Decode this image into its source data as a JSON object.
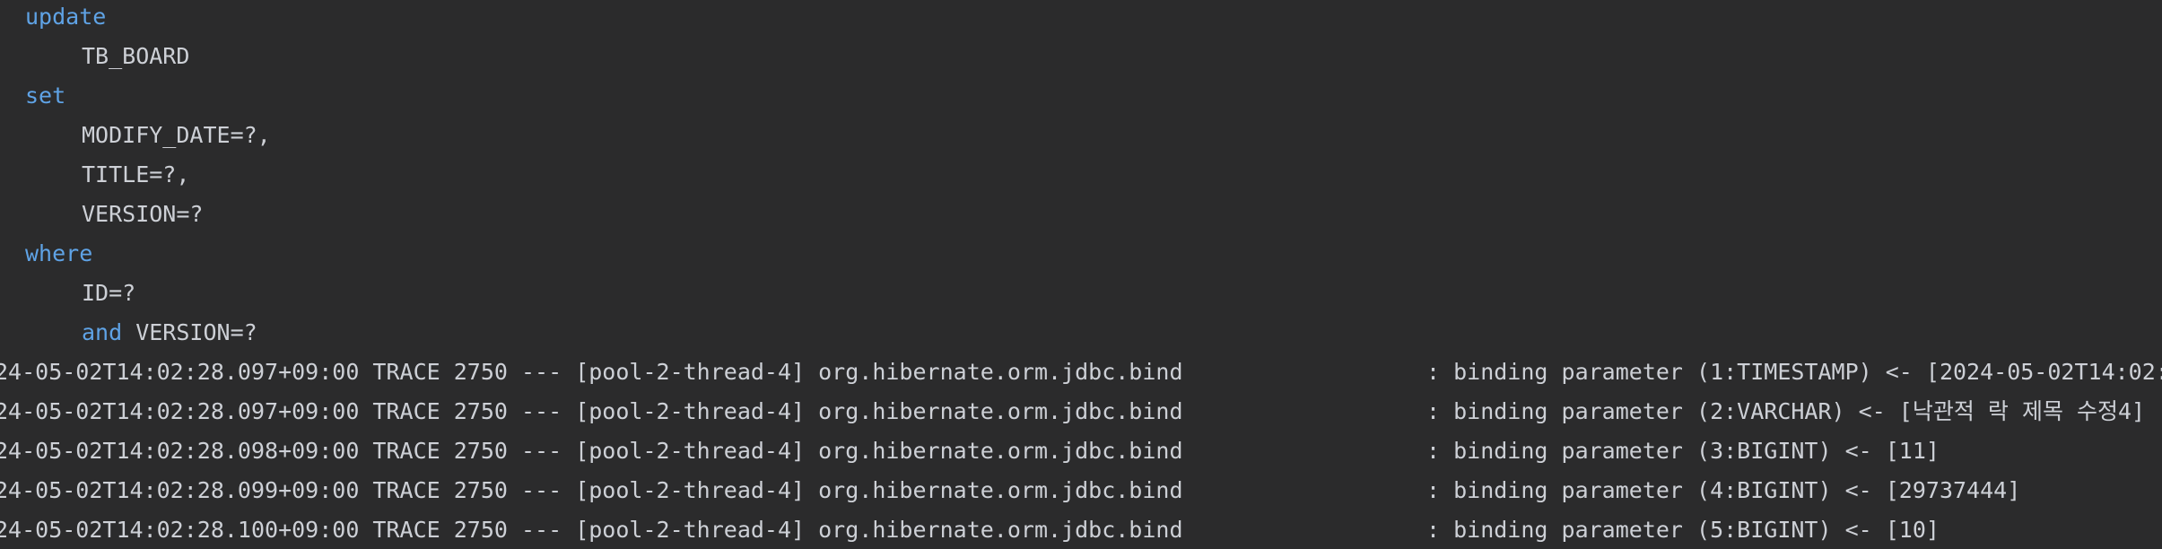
{
  "sql": {
    "kw_update": "update",
    "table": "TB_BOARD",
    "kw_set": "set",
    "col_modify_date": "MODIFY_DATE=?,",
    "col_title": "TITLE=?,",
    "col_version": "VERSION=?",
    "kw_where": "where",
    "cond_id": "ID=?",
    "kw_and": "and",
    "cond_version": " VERSION=?"
  },
  "logs": [
    {
      "prefix": "24-05-02T14:02:28.097+09:00 TRACE 2750 --- [pool-2-thread-4] org.hibernate.orm.jdbc.bind",
      "message": ": binding parameter (1:TIMESTAMP) <- [2024-05-02T14:02:"
    },
    {
      "prefix": "24-05-02T14:02:28.097+09:00 TRACE 2750 --- [pool-2-thread-4] org.hibernate.orm.jdbc.bind",
      "message": ": binding parameter (2:VARCHAR) <- [낙관적 락 제목 수정4]"
    },
    {
      "prefix": "24-05-02T14:02:28.098+09:00 TRACE 2750 --- [pool-2-thread-4] org.hibernate.orm.jdbc.bind",
      "message": ": binding parameter (3:BIGINT) <- [11]"
    },
    {
      "prefix": "24-05-02T14:02:28.099+09:00 TRACE 2750 --- [pool-2-thread-4] org.hibernate.orm.jdbc.bind",
      "message": ": binding parameter (4:BIGINT) <- [29737444]"
    },
    {
      "prefix": "24-05-02T14:02:28.100+09:00 TRACE 2750 --- [pool-2-thread-4] org.hibernate.orm.jdbc.bind",
      "message": ": binding parameter (5:BIGINT) <- [10]"
    }
  ]
}
